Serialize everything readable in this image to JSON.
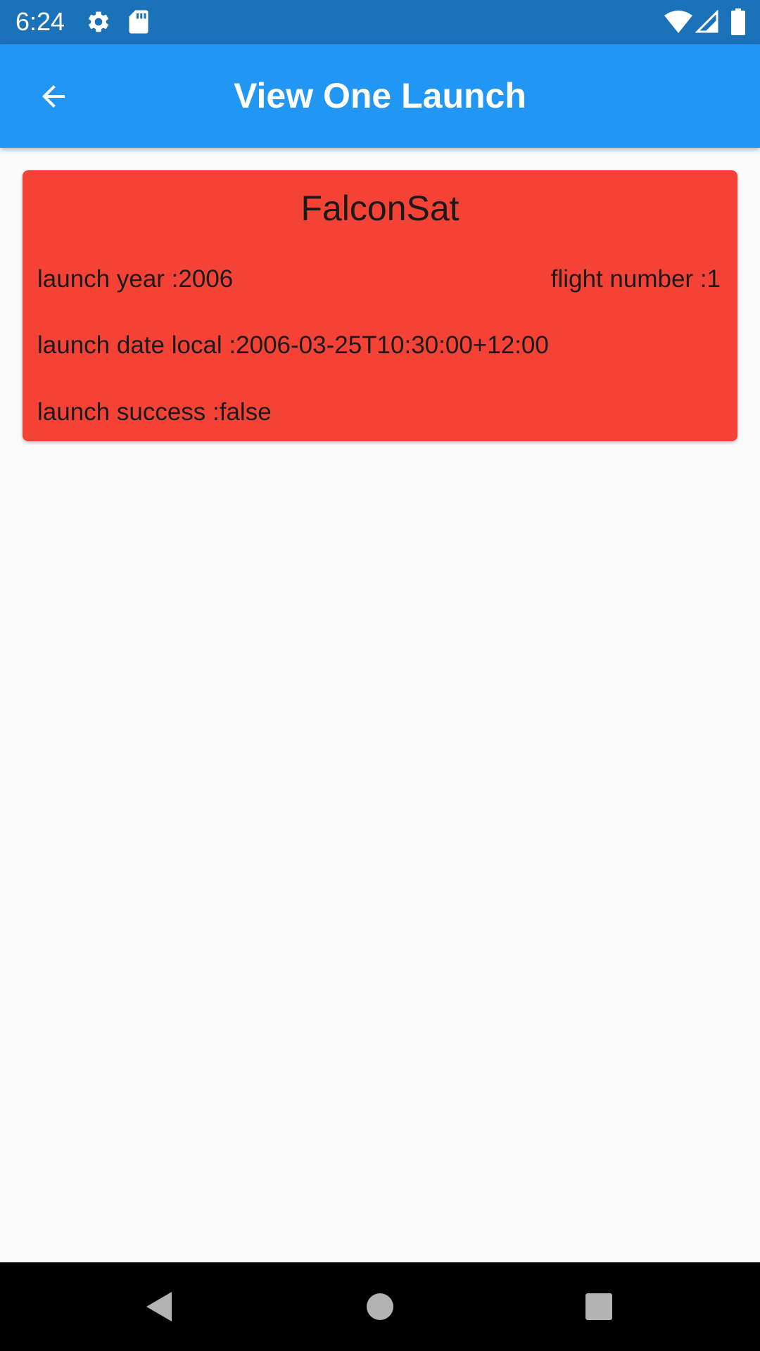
{
  "status_bar": {
    "time": "6:24",
    "left_icons": [
      "gear-icon",
      "sd-card-icon"
    ],
    "right_icons": [
      "wifi-icon",
      "cell-signal-icon",
      "battery-icon"
    ],
    "background_color": "#1b72b9"
  },
  "app_bar": {
    "title": "View One Launch",
    "back_icon": "arrow-back-icon",
    "background_color": "#2196f3"
  },
  "launch_card": {
    "mission_name": "FalconSat",
    "launch_year_text": "launch year :2006",
    "flight_number_text": "flight number :1",
    "launch_date_local_text": "launch date local :2006-03-25T10:30:00+12:00",
    "launch_success_text": "launch success :false",
    "background_color": "#f44336"
  },
  "nav_bar": {
    "buttons": [
      "back-triangle-icon",
      "home-circle-icon",
      "recents-square-icon"
    ]
  }
}
